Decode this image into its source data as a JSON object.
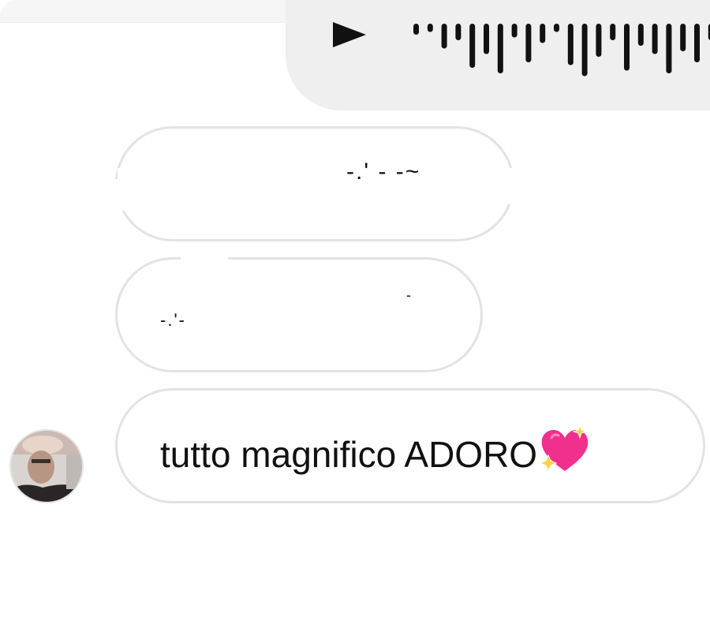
{
  "conversation": {
    "voice_message": {
      "icon": "play-icon",
      "waveform_bars": [
        0.2,
        0.15,
        0.45,
        0.3,
        0.8,
        0.55,
        0.9,
        0.25,
        0.7,
        0.35,
        0.15,
        0.75,
        0.95,
        0.6,
        0.3,
        0.85,
        0.4,
        0.55,
        0.9,
        0.5,
        0.7,
        0.3
      ]
    },
    "messages": [
      {
        "id": "redacted-1",
        "text": ""
      },
      {
        "id": "redacted-2",
        "text": ""
      },
      {
        "id": "reply",
        "text": "tutto magnifico ADORO",
        "emoji_icon": "sparkling-heart-icon"
      }
    ],
    "avatar": {
      "icon": "user-avatar-photo"
    }
  },
  "colors": {
    "incoming_bubble_border": "#e3e3e3",
    "voice_bubble": "#efefef",
    "heart_pink": "#f0308c",
    "sparkle_yellow": "#ffd43b"
  }
}
